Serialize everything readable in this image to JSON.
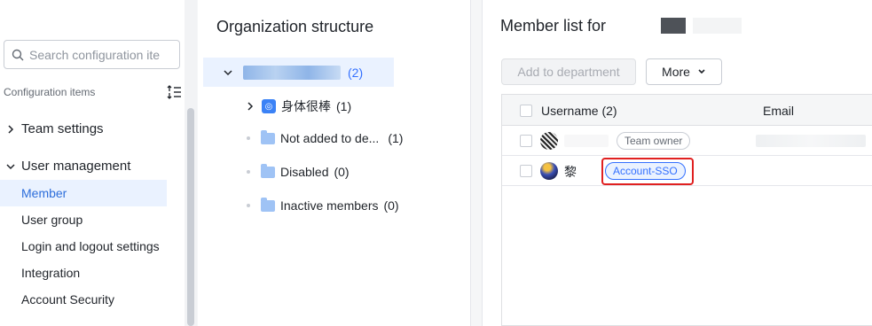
{
  "sidebar": {
    "search_placeholder": "Search configuration ite",
    "config_title": "Configuration items",
    "groups": [
      {
        "label": "Team settings",
        "expanded": false
      },
      {
        "label": "User management",
        "expanded": true
      }
    ],
    "items": [
      {
        "label": "Member",
        "active": true
      },
      {
        "label": "User group",
        "active": false
      },
      {
        "label": "Login and logout settings",
        "active": false
      },
      {
        "label": "Integration",
        "active": false
      },
      {
        "label": "Account Security",
        "active": false
      }
    ]
  },
  "org": {
    "title": "Organization structure",
    "root_count": "(2)",
    "children": [
      {
        "label": "身体很棒",
        "count": "(1)",
        "icon": "department-icon",
        "expandable": true
      },
      {
        "label": "Not added to de...",
        "count": "(1)",
        "icon": "folder-icon"
      },
      {
        "label": "Disabled",
        "count": "(0)",
        "icon": "folder-icon"
      },
      {
        "label": "Inactive members",
        "count": "(0)",
        "icon": "folder-icon"
      }
    ]
  },
  "members": {
    "title": "Member list for",
    "add_button": "Add to department",
    "more_button": "More",
    "columns": {
      "username": "Username (2)",
      "email": "Email"
    },
    "rows": [
      {
        "name": "",
        "tag": "Team owner"
      },
      {
        "name": "黎",
        "tag": "Account-SSO"
      }
    ]
  },
  "colors": {
    "accent": "#3370ff",
    "active_bg": "#eaf2ff",
    "highlight": "#e02020"
  }
}
